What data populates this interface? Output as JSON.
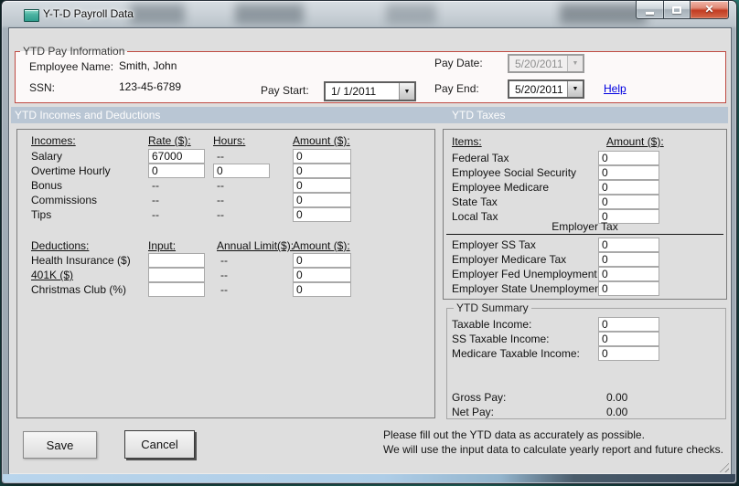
{
  "window": {
    "title": "Y-T-D Payroll Data"
  },
  "pay_info": {
    "legend": "YTD Pay Information",
    "employee_name_label": "Employee Name:",
    "employee_name": "Smith, John",
    "ssn_label": "SSN:",
    "ssn": "123-45-6789",
    "pay_start_label": "Pay Start:",
    "pay_start": "1/ 1/2011",
    "pay_date_label": "Pay Date:",
    "pay_date": "5/20/2011",
    "pay_end_label": "Pay End:",
    "pay_end": "5/20/2011",
    "help_link": "Help"
  },
  "incomes_panel": {
    "header": "YTD Incomes and Deductions",
    "incomes": {
      "col_item": "Incomes:",
      "col_rate": "Rate ($):",
      "col_hours": "Hours:",
      "col_amount": "Amount ($):",
      "rows": [
        {
          "label": "Salary",
          "rate": {
            "type": "input",
            "value": "67000"
          },
          "hours": {
            "type": "dash",
            "value": "--"
          },
          "amount": {
            "type": "input",
            "value": "0"
          }
        },
        {
          "label": "Overtime Hourly",
          "rate": {
            "type": "input",
            "value": "0"
          },
          "hours": {
            "type": "input",
            "value": "0"
          },
          "amount": {
            "type": "input",
            "value": "0"
          }
        },
        {
          "label": "Bonus",
          "rate": {
            "type": "dash",
            "value": "--"
          },
          "hours": {
            "type": "dash",
            "value": "--"
          },
          "amount": {
            "type": "input",
            "value": "0"
          }
        },
        {
          "label": "Commissions",
          "rate": {
            "type": "dash",
            "value": "--"
          },
          "hours": {
            "type": "dash",
            "value": "--"
          },
          "amount": {
            "type": "input",
            "value": "0"
          }
        },
        {
          "label": "Tips",
          "rate": {
            "type": "dash",
            "value": "--"
          },
          "hours": {
            "type": "dash",
            "value": "--"
          },
          "amount": {
            "type": "input",
            "value": "0"
          }
        }
      ]
    },
    "deductions": {
      "col_item": "Deductions:",
      "col_input": "Input:",
      "col_limit": "Annual Limit($):",
      "col_amount": "Amount ($):",
      "rows": [
        {
          "label": "Health Insurance ($)",
          "underline": false,
          "input": {
            "type": "input",
            "value": ""
          },
          "limit": {
            "type": "dash",
            "value": "--"
          },
          "amount": {
            "type": "input",
            "value": "0"
          }
        },
        {
          "label": "401K ($)",
          "underline": true,
          "input": {
            "type": "input",
            "value": ""
          },
          "limit": {
            "type": "dash",
            "value": "--"
          },
          "amount": {
            "type": "input",
            "value": "0"
          }
        },
        {
          "label": "Christmas Club (%)",
          "underline": false,
          "input": {
            "type": "input",
            "value": ""
          },
          "limit": {
            "type": "dash",
            "value": "--"
          },
          "amount": {
            "type": "input",
            "value": "0"
          }
        }
      ]
    }
  },
  "taxes_panel": {
    "header": "YTD Taxes",
    "col_item": "Items:",
    "col_amount": "Amount ($):",
    "employee_rows": [
      {
        "label": "Federal Tax",
        "amount": "0"
      },
      {
        "label": "Employee Social Security",
        "amount": "0"
      },
      {
        "label": "Employee Medicare",
        "amount": "0"
      },
      {
        "label": "State Tax",
        "amount": "0"
      },
      {
        "label": "Local Tax",
        "amount": "0"
      }
    ],
    "employer_divider": "Employer Tax",
    "employer_rows": [
      {
        "label": "Employer SS Tax",
        "amount": "0"
      },
      {
        "label": "Employer Medicare Tax",
        "amount": "0"
      },
      {
        "label": "Employer Fed Unemployment",
        "amount": "0"
      },
      {
        "label": "Employer State Unemployment",
        "amount": "0"
      }
    ]
  },
  "summary": {
    "legend": "YTD Summary",
    "rows": [
      {
        "label": "Taxable Income:",
        "amount": "0"
      },
      {
        "label": "SS Taxable Income:",
        "amount": "0"
      },
      {
        "label": "Medicare Taxable Income:",
        "amount": "0"
      }
    ],
    "gross_label": "Gross Pay:",
    "gross_value": "0.00",
    "net_label": "Net Pay:",
    "net_value": "0.00"
  },
  "footer": {
    "save_label": "Save",
    "cancel_label": "Cancel",
    "note_line1": "Please fill out the YTD data as accurately as possible.",
    "note_line2": "We will use the input data to calculate yearly report and future checks."
  },
  "colors": {
    "groupbox_accent_border": "#bf4a42",
    "section_header_bg": "#b9c6d4",
    "client_bg": "#dedede",
    "help_link": "#0000e0",
    "close_button": "#c33c22"
  }
}
